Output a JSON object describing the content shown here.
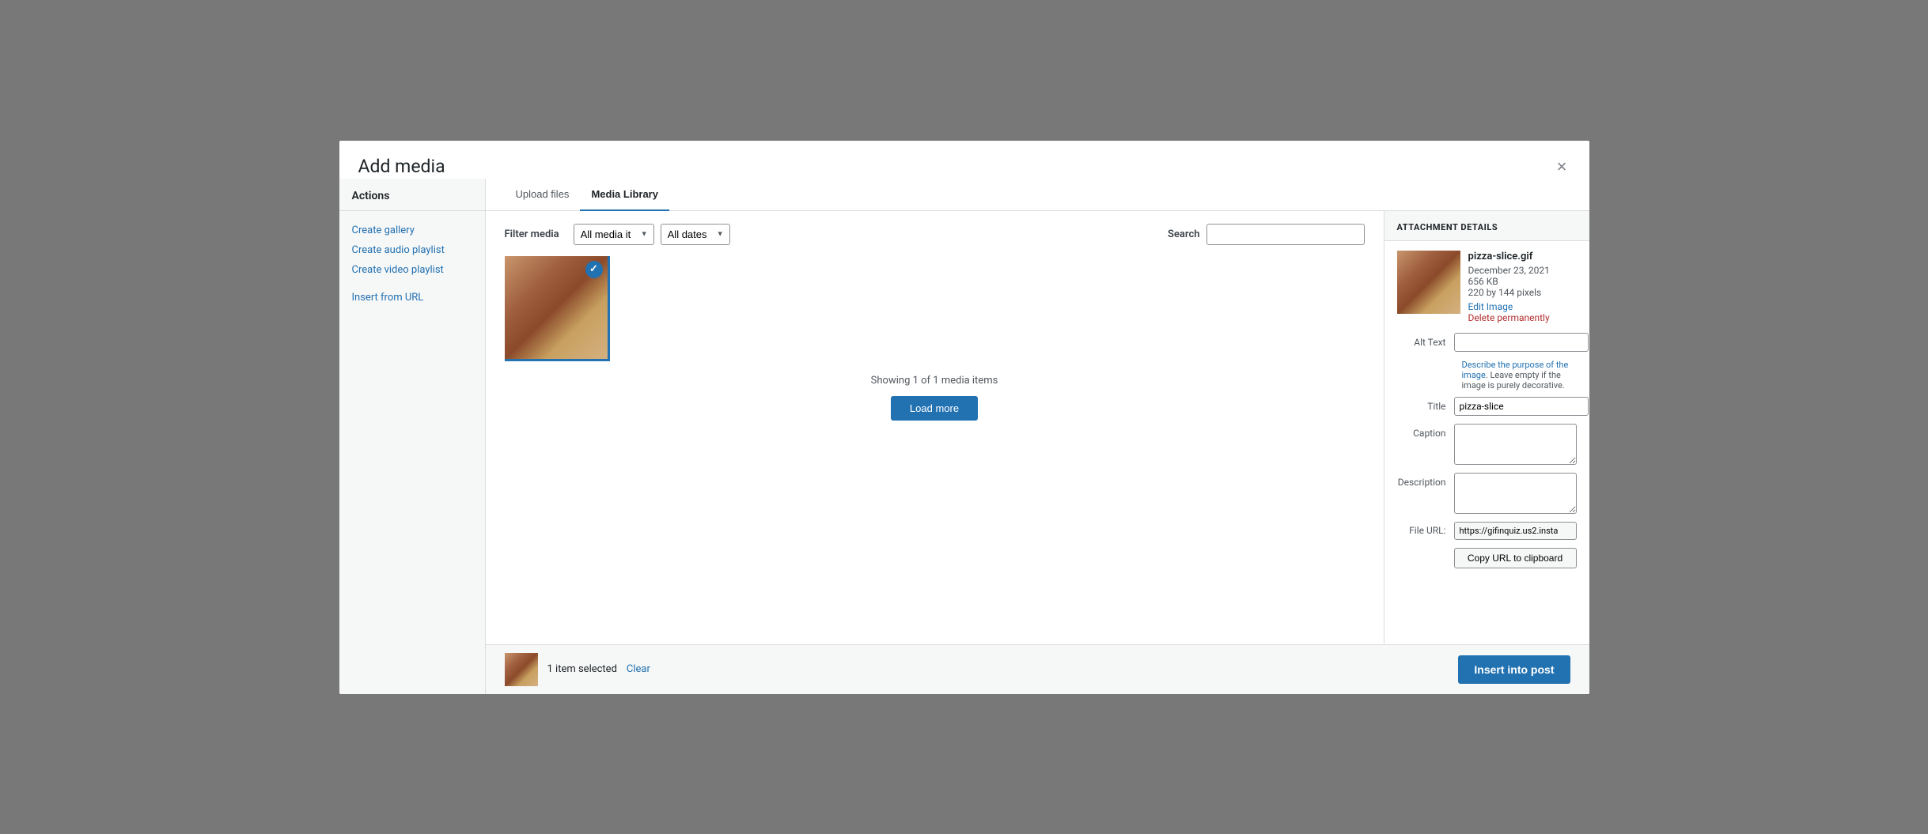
{
  "modal": {
    "title": "Add media",
    "close_label": "×"
  },
  "sidebar": {
    "actions_label": "Actions",
    "nav_items": [
      {
        "id": "create-gallery",
        "label": "Create gallery"
      },
      {
        "id": "create-audio-playlist",
        "label": "Create audio playlist"
      },
      {
        "id": "create-video-playlist",
        "label": "Create video playlist"
      }
    ],
    "insert_from_url_label": "Insert from URL"
  },
  "tabs": [
    {
      "id": "upload-files",
      "label": "Upload files",
      "active": false
    },
    {
      "id": "media-library",
      "label": "Media Library",
      "active": true
    }
  ],
  "filter": {
    "label": "Filter media",
    "all_media_label": "All media it",
    "all_dates_label": "All dates",
    "search_label": "Search"
  },
  "grid": {
    "showing_text": "Showing 1 of 1 media items",
    "load_more_label": "Load more"
  },
  "attachment": {
    "section_label": "ATTACHMENT DETAILS",
    "filename": "pizza-slice.gif",
    "date": "December 23, 2021",
    "size": "656 KB",
    "dimensions": "220 by 144 pixels",
    "edit_image_label": "Edit Image",
    "delete_label": "Delete permanently",
    "alt_text_label": "Alt Text",
    "alt_text_value": "",
    "alt_text_hint_link": "Describe the purpose of the image",
    "alt_text_hint_rest": ". Leave empty if the image is purely decorative.",
    "title_label": "Title",
    "title_value": "pizza-slice",
    "caption_label": "Caption",
    "caption_value": "",
    "description_label": "Description",
    "description_value": "",
    "file_url_label": "File URL:",
    "file_url_value": "https://gifinquiz.us2.insta",
    "copy_url_label": "Copy URL to clipboard"
  },
  "footer": {
    "selected_count_label": "1 item selected",
    "clear_label": "Clear",
    "insert_btn_label": "Insert into post"
  }
}
